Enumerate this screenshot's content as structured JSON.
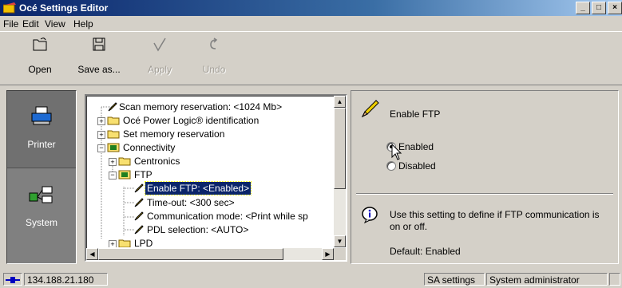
{
  "window": {
    "title": "Océ Settings Editor"
  },
  "menu": {
    "items": [
      "File",
      "Edit",
      "View",
      "Help"
    ]
  },
  "toolbar": {
    "open": "Open",
    "save_as": "Save as...",
    "apply": "Apply",
    "undo": "Undo"
  },
  "nav": {
    "printer": "Printer",
    "system": "System"
  },
  "tree": {
    "items": [
      "Scan memory reservation: <1024 Mb>",
      "Océ Power Logic® identification",
      "Set memory reservation",
      "Connectivity",
      "Centronics",
      "FTP",
      "Enable FTP: <Enabled>",
      "Time-out: <300 sec>",
      "Communication mode: <Print while sp",
      "PDL selection: <AUTO>",
      "LPD"
    ]
  },
  "detail": {
    "title": "Enable FTP",
    "options": [
      "Enabled",
      "Disabled"
    ],
    "selected": "Enabled",
    "info": "Use this setting to define if FTP communication is on or off.",
    "default": "Default: Enabled"
  },
  "status": {
    "ip": "134.188.21.180",
    "mode": "SA settings",
    "user": "System administrator"
  },
  "colors": {
    "titlebar": "#0a246a",
    "face": "#d4d0c8",
    "selection": "#0a246a"
  }
}
